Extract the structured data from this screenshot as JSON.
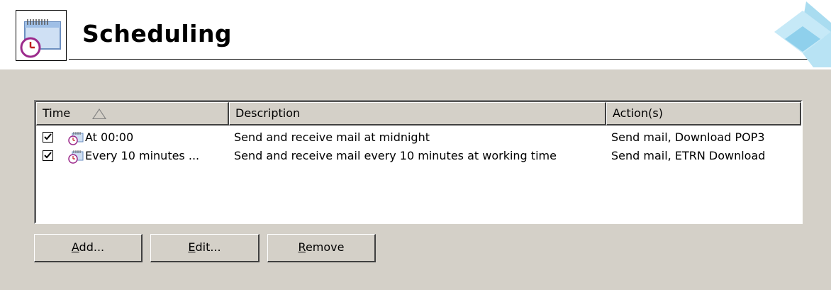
{
  "header": {
    "title": "Scheduling"
  },
  "list": {
    "columns": [
      "Time",
      "Description",
      "Action(s)"
    ],
    "sort_column": "Time",
    "sort_direction": "ascending",
    "rows": [
      {
        "checked": true,
        "time": "At 00:00",
        "description": "Send and receive mail at midnight",
        "actions": "Send mail, Download POP3"
      },
      {
        "checked": true,
        "time": "Every 10 minutes ...",
        "description": "Send and receive mail every 10 minutes at working time",
        "actions": "Send mail, ETRN Download"
      }
    ]
  },
  "buttons": {
    "add": {
      "mnemonic": "A",
      "rest": "dd..."
    },
    "edit": {
      "mnemonic": "E",
      "rest": "dit..."
    },
    "remove": {
      "mnemonic": "R",
      "rest": "emove"
    }
  },
  "icons": {
    "header": "calendar-clock-icon",
    "row": "calendar-clock-icon",
    "corner": "diamond-decoration-icon"
  }
}
